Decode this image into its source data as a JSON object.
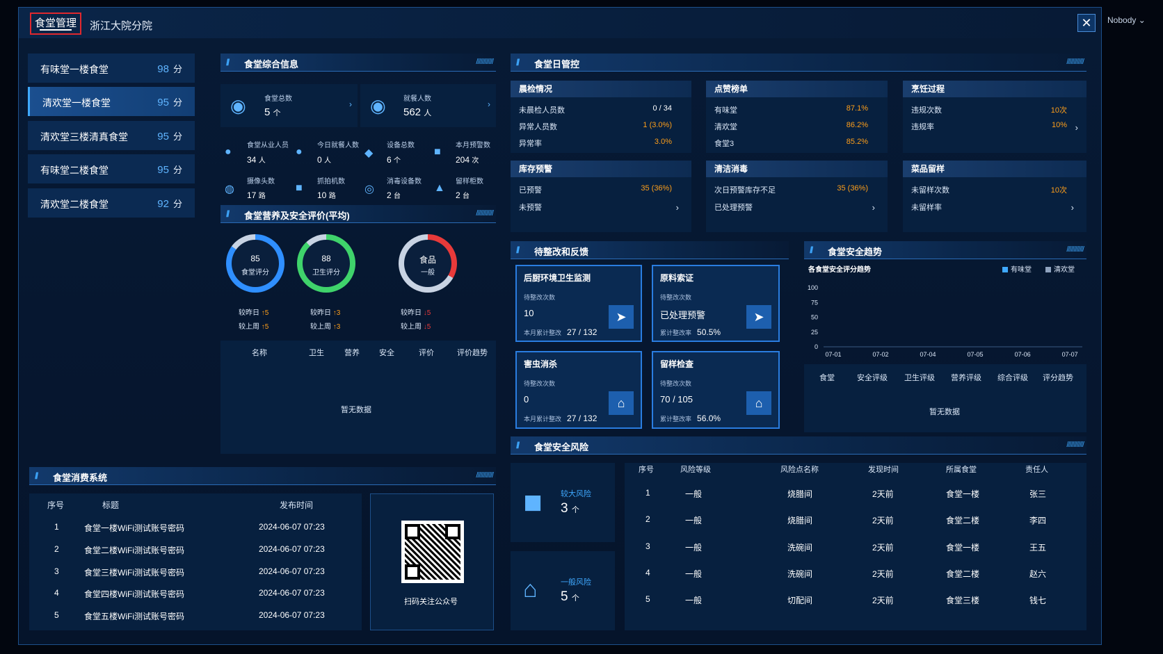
{
  "header": {
    "tab_active": "食堂管理",
    "tab_branch": "浙江大院分院",
    "close_glyph": "✕",
    "user": "Nobody",
    "user_caret": "⌄"
  },
  "canteens": [
    {
      "name": "有味堂一楼食堂",
      "score": "98",
      "unit": "分"
    },
    {
      "name": "清欢堂一楼食堂",
      "score": "95",
      "unit": "分"
    },
    {
      "name": "清欢堂三楼清真食堂",
      "score": "95",
      "unit": "分"
    },
    {
      "name": "有味堂二楼食堂",
      "score": "95",
      "unit": "分"
    },
    {
      "name": "清欢堂二楼食堂",
      "score": "92",
      "unit": "分"
    }
  ],
  "overview": {
    "title": "食堂综合信息",
    "total_label": "食堂总数",
    "total_value": "5",
    "total_unit": "个",
    "diners_label": "就餐人数",
    "diners_value": "562",
    "diners_unit": "人",
    "stats": [
      {
        "label": "食堂从业人员",
        "value": "34",
        "unit": "人",
        "icon": "staff-icon"
      },
      {
        "label": "今日就餐人数",
        "value": "0",
        "unit": "人",
        "icon": "diner-icon"
      },
      {
        "label": "设备总数",
        "value": "6",
        "unit": "个",
        "icon": "device-icon"
      },
      {
        "label": "本月预警数",
        "value": "204",
        "unit": "次",
        "icon": "warning-icon"
      },
      {
        "label": "摄像头数",
        "value": "17",
        "unit": "路",
        "icon": "camera-icon"
      },
      {
        "label": "抓拍机数",
        "value": "10",
        "unit": "路",
        "icon": "snapshot-icon"
      },
      {
        "label": "消毒设备数",
        "value": "2",
        "unit": "台",
        "icon": "disinfect-icon"
      },
      {
        "label": "留样柜数",
        "value": "2",
        "unit": "台",
        "icon": "sample-cabinet-icon"
      }
    ]
  },
  "evaluation": {
    "title": "食堂营养及安全评价(平均)",
    "circles": [
      {
        "value": "85",
        "label": "食堂评分",
        "cmp1": "较昨日",
        "d1": "↑5",
        "cmp2": "较上周",
        "d2": "↑5",
        "color": "#2f8fff"
      },
      {
        "value": "88",
        "label": "卫生评分",
        "cmp1": "较昨日",
        "d1": "↑3",
        "cmp2": "较上周",
        "d2": "↑3",
        "color": "#3fd36b"
      },
      {
        "value": "食品",
        "label": "一般",
        "cmp1": "较昨日",
        "d1": "↓5",
        "cmp2": "较上周",
        "d2": "↓5",
        "color": "#e83a3a"
      }
    ],
    "columns": [
      "名称",
      "卫生",
      "营养",
      "安全",
      "评价",
      "评价趋势"
    ],
    "empty": "暂无数据"
  },
  "daily": {
    "title": "食堂日管控",
    "morning": {
      "title": "晨检情况",
      "rows": [
        {
          "label": "未晨检人员数",
          "value": "0 / 34"
        },
        {
          "label": "异常人员数",
          "value": "1 (3.0%)"
        },
        {
          "label": "异常率",
          "value": "3.0%"
        }
      ]
    },
    "ranking": {
      "title": "点赞榜单",
      "rows": [
        {
          "label": "有味堂",
          "value": "87.1%"
        },
        {
          "label": "清欢堂",
          "value": "86.2%"
        },
        {
          "label": "食堂3",
          "value": "85.2%"
        }
      ]
    },
    "cooking": {
      "title": "烹饪过程",
      "rows": [
        {
          "label": "违规次数",
          "value": "10次"
        },
        {
          "label": "违规率",
          "value": "10%"
        }
      ]
    },
    "inventory": {
      "title": "库存预警",
      "rows": [
        {
          "label": "已预警",
          "value": "35 (36%)"
        },
        {
          "label": "未预警",
          "value": ""
        }
      ]
    },
    "cleaning": {
      "title": "清洁消毒",
      "rows": [
        {
          "label": "次日预警库存不足",
          "value": "35 (36%)"
        },
        {
          "label": "已处理预警",
          "value": ""
        }
      ]
    },
    "sample": {
      "title": "菜品留样",
      "rows": [
        {
          "label": "未留样次数",
          "value": "10次"
        },
        {
          "label": "未留样率",
          "value": ""
        }
      ]
    }
  },
  "rectify": {
    "title": "待整改和反馈",
    "cards": [
      {
        "title": "后厨环境卫生监测",
        "sub": "待整改次数",
        "big": "10",
        "foot": "本月累计整改",
        "foot_val": "27 / 132"
      },
      {
        "title": "原料索证",
        "sub": "待整改次数",
        "big": "已处理预警",
        "foot": "累计整改率",
        "foot_val": "50.5%"
      },
      {
        "title": "害虫消杀",
        "sub": "待整改次数",
        "big": "0",
        "foot": "本月累计整改",
        "foot_val": "27 / 132"
      },
      {
        "title": "留样检查",
        "sub": "待整改次数",
        "big": "70 / 105",
        "foot": "累计整改率",
        "foot_val": "56.0%"
      }
    ]
  },
  "trend": {
    "title": "食堂安全趋势",
    "subtitle": "各食堂安全评分趋势",
    "legend": [
      {
        "name": "有味堂",
        "color": "#3fa9ff"
      },
      {
        "name": "清欢堂",
        "color": "#8fa3bf"
      }
    ],
    "columns": [
      "食堂",
      "安全评级",
      "卫生评级",
      "营养评级",
      "综合评级",
      "评分趋势"
    ],
    "empty": "暂无数据"
  },
  "chart_data": {
    "type": "line",
    "title": "各食堂安全评分趋势",
    "x": [
      "07-01",
      "07-02",
      "07-04",
      "07-05",
      "07-06",
      "07-07"
    ],
    "y_ticks": [
      "100",
      "75",
      "50",
      "25",
      "0"
    ],
    "ylim": [
      0,
      100
    ],
    "series": [
      {
        "name": "有味堂",
        "values": []
      },
      {
        "name": "清欢堂",
        "values": []
      }
    ]
  },
  "risk": {
    "title": "食堂安全风险",
    "major_label": "较大风险",
    "major_value": "3",
    "major_unit": "个",
    "general_label": "一般风险",
    "general_value": "5",
    "general_unit": "个",
    "columns": [
      "序号",
      "风险等级",
      "风险点名称",
      "发现时间",
      "所属食堂",
      "责任人"
    ],
    "rows": [
      [
        "1",
        "一般",
        "烧腊间",
        "2天前",
        "食堂一楼",
        "张三"
      ],
      [
        "2",
        "一般",
        "烧腊间",
        "2天前",
        "食堂二楼",
        "李四"
      ],
      [
        "3",
        "一般",
        "洗碗间",
        "2天前",
        "食堂一楼",
        "王五"
      ],
      [
        "4",
        "一般",
        "洗碗间",
        "2天前",
        "食堂二楼",
        "赵六"
      ],
      [
        "5",
        "一般",
        "切配间",
        "2天前",
        "食堂三楼",
        "钱七"
      ]
    ]
  },
  "consumption": {
    "title": "食堂消费系统",
    "columns": [
      "序号",
      "标题",
      "发布时间"
    ],
    "rows": [
      [
        "1",
        "食堂一楼WiFi测试账号密码",
        "2024-06-07 07:23"
      ],
      [
        "2",
        "食堂二楼WiFi测试账号密码",
        "2024-06-07 07:23"
      ],
      [
        "3",
        "食堂三楼WiFi测试账号密码",
        "2024-06-07 07:23"
      ],
      [
        "4",
        "食堂四楼WiFi测试账号密码",
        "2024-06-07 07:23"
      ],
      [
        "5",
        "食堂五楼WiFi测试账号密码",
        "2024-06-07 07:23"
      ]
    ],
    "qr_caption": "扫码关注公众号"
  }
}
